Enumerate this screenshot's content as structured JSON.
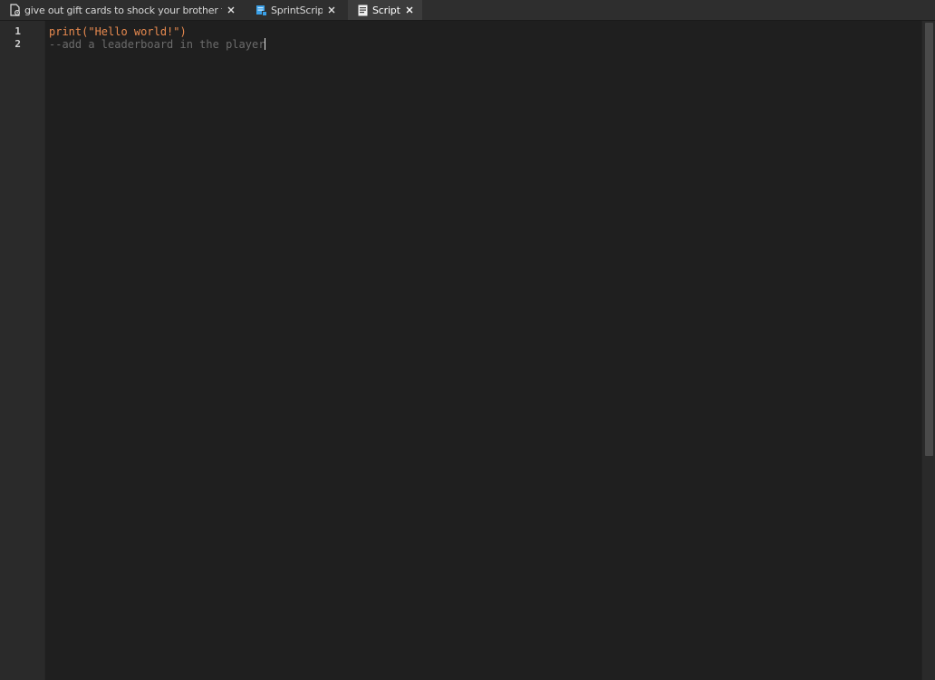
{
  "tabs": [
    {
      "label": "give out gift cards to shock your brother tycoon",
      "icon": "place-document-icon",
      "active": false
    },
    {
      "label": "SprintScript",
      "icon": "local-script-icon",
      "active": false
    },
    {
      "label": "Script",
      "icon": "script-icon",
      "active": true
    }
  ],
  "editor": {
    "line_numbers": [
      "1",
      "2"
    ],
    "lines": [
      {
        "func": "print",
        "open": "(",
        "string": "\"Hello world!\"",
        "close": ")"
      },
      {
        "comment": "--add a leaderboard in the player"
      }
    ]
  },
  "colors": {
    "background": "#1f1f1f",
    "gutter": "#2a2a2a",
    "code_accent": "#e88a4f",
    "comment": "#6b6b6b",
    "local_script_icon": "#3aa0e8"
  }
}
